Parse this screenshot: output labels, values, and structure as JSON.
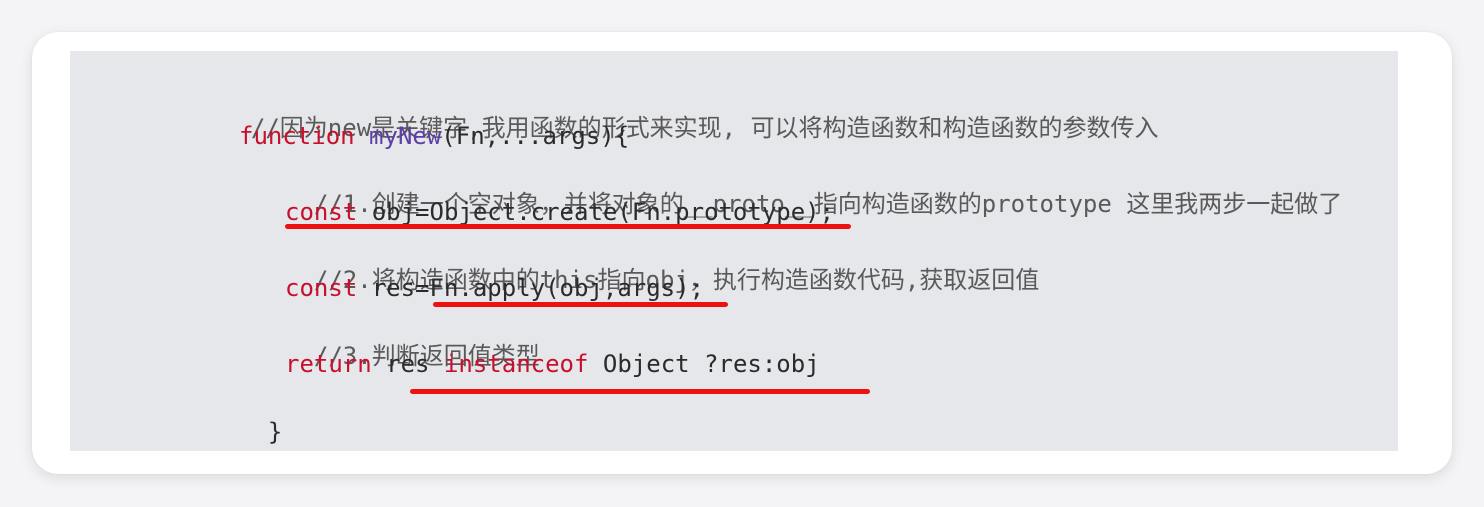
{
  "code": {
    "line1_comment": "//因为new是关键字,我用函数的形式来实现, 可以将构造函数和构造函数的参数传入",
    "line2_keyword": "function",
    "line2_space": " ",
    "line2_fn": "myNew",
    "line2_rest": "(Fn,...args){",
    "line3_comment": "//1.创建一个空对象，并将对象的__proto__指向构造函数的prototype 这里我两步一起做了",
    "line4_keyword": "const",
    "line4_rest": " obj=Object.create(Fn.prototype);",
    "line5_comment": "//2.将构造函数中的this指向obj，执行构造函数代码,获取返回值",
    "line6_keyword": "const",
    "line6_rest": " res=Fn.apply(obj,args);",
    "line7_comment": "//3.判断返回值类型",
    "line8_keyword": "return",
    "line8_mid": " res ",
    "line8_keyword2": "instanceof",
    "line8_rest": " Object ?res:obj",
    "line9": "}"
  },
  "colors": {
    "keyword": "#c8102e",
    "function_name": "#5d3fa5",
    "underline": "#ee1111",
    "code_background": "#e6e7ea"
  }
}
